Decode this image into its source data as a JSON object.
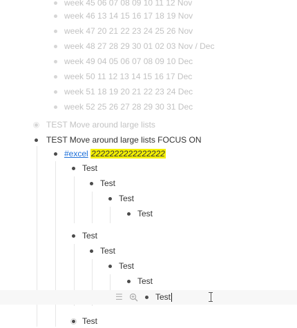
{
  "weeks": [
    "week 45 06 07 08 09 10 11 12 Nov",
    "week 46 13 14 15 16 17 18 19 Nov",
    "week 47 20 21 22 23 24 25 26 Nov",
    "week 48 27 28 29 30 01 02 03 Nov / Dec",
    "week 49 04 05 06 07 08 09 10 Dec",
    "week 50 11 12 13 14 15 16 17 Dec",
    "week 51 18 19 20 21 22 23 24 Dec",
    "week 52 25 26 27 28 29 30 31 Dec"
  ],
  "test_faded": "TEST Move around large lists",
  "test_focus": "TEST Move around large lists  FOCUS ON",
  "excel_tag": "#excel",
  "excel_highlight": "2222222222222222",
  "test_label": "Test"
}
